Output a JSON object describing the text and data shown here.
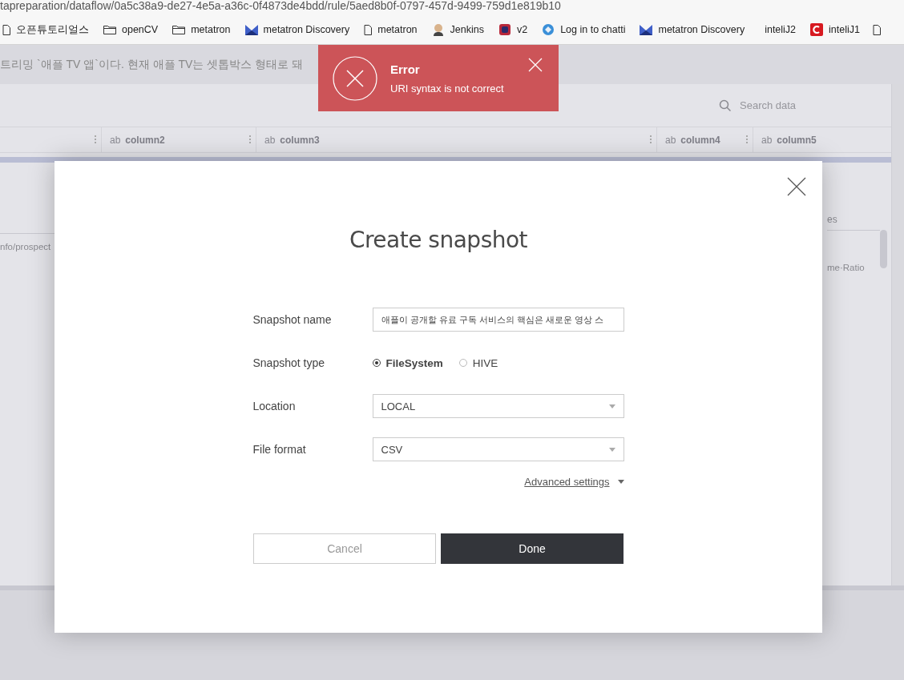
{
  "browser": {
    "url": "tapreparation/dataflow/0a5c38a9-de27-4e5a-a36c-0f4873de4bdd/rule/5aed8b0f-0797-457d-9499-759d1e819b10",
    "bookmarks": [
      {
        "label": "오픈튜토리얼스",
        "kind": "file"
      },
      {
        "label": "openCV",
        "kind": "folder"
      },
      {
        "label": "metatron",
        "kind": "folder"
      },
      {
        "label": "metatron Discovery",
        "kind": "logo"
      },
      {
        "label": "metatron",
        "kind": "file"
      },
      {
        "label": "Jenkins",
        "kind": "person"
      },
      {
        "label": "v2",
        "kind": "badge"
      },
      {
        "label": "Log in to chatti",
        "kind": "globe"
      },
      {
        "label": "metatron Discovery",
        "kind": "logo"
      },
      {
        "label": "inteliJ2",
        "kind": "blank"
      },
      {
        "label": "inteliJ1",
        "kind": "red"
      }
    ]
  },
  "banner": {
    "text": "트리밍 `애플 TV 앱`이다. 현재 애플 TV는 셋톱박스 형태로 돼"
  },
  "search": {
    "placeholder": "Search data"
  },
  "table": {
    "columns": [
      {},
      {
        "type": "ab",
        "name": "column2"
      },
      {
        "type": "ab",
        "name": "column3"
      },
      {
        "type": "ab",
        "name": "column4"
      },
      {
        "type": "ab",
        "name": "column5"
      }
    ],
    "left_cell": "nfo/prospect",
    "right_header": "es",
    "right_cell": "me·Ratio"
  },
  "toast": {
    "title": "Error",
    "message": "URI syntax is not correct"
  },
  "dialog": {
    "title": "Create snapshot",
    "name_label": "Snapshot name",
    "name_value": "애플이 공개할 유료 구독 서비스의 핵심은 새로운 영상 스",
    "type_label": "Snapshot type",
    "types": [
      {
        "label": "FileSystem",
        "selected": true
      },
      {
        "label": "HIVE",
        "selected": false
      }
    ],
    "selects": [
      {
        "label": "Location",
        "value": "LOCAL"
      },
      {
        "label": "File format",
        "value": "CSV"
      }
    ],
    "advanced": "Advanced settings",
    "cancel": "Cancel",
    "done": "Done"
  }
}
